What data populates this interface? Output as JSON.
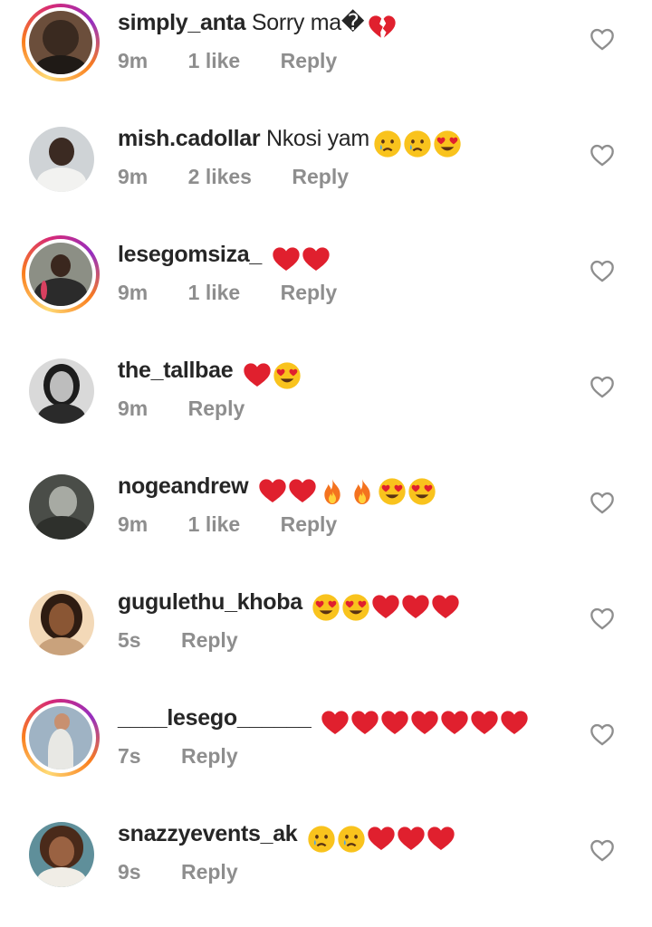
{
  "comments": [
    {
      "username": "simply_anta",
      "text": "Sorry ma�",
      "emojis": [
        "broken-heart"
      ],
      "time": "9m",
      "likes": "1 like",
      "reply": "Reply",
      "story": true
    },
    {
      "username": "mish.cadollar",
      "text": "Nkosi yam",
      "emojis": [
        "crying-face",
        "crying-face",
        "heart-eyes"
      ],
      "time": "9m",
      "likes": "2 likes",
      "reply": "Reply",
      "story": false
    },
    {
      "username": "lesegomsiza_",
      "text": "",
      "emojis": [
        "red-heart",
        "red-heart"
      ],
      "time": "9m",
      "likes": "1 like",
      "reply": "Reply",
      "story": true
    },
    {
      "username": "the_tallbae",
      "text": "",
      "emojis": [
        "red-heart",
        "heart-eyes"
      ],
      "time": "9m",
      "likes": "",
      "reply": "Reply",
      "story": false
    },
    {
      "username": "nogeandrew",
      "text": "",
      "emojis": [
        "red-heart",
        "red-heart",
        "fire",
        "fire",
        "heart-eyes",
        "heart-eyes"
      ],
      "time": "9m",
      "likes": "1 like",
      "reply": "Reply",
      "story": false
    },
    {
      "username": "gugulethu_khoba",
      "text": "",
      "emojis": [
        "heart-eyes",
        "heart-eyes",
        "red-heart",
        "red-heart",
        "red-heart"
      ],
      "time": "5s",
      "likes": "",
      "reply": "Reply",
      "story": false
    },
    {
      "username": "____lesego______",
      "text": "",
      "emojis": [
        "red-heart",
        "red-heart",
        "red-heart",
        "red-heart",
        "red-heart",
        "red-heart",
        "red-heart"
      ],
      "time": "7s",
      "likes": "",
      "reply": "Reply",
      "story": true
    },
    {
      "username": "snazzyevents_ak",
      "text": "",
      "emojis": [
        "crying-face",
        "crying-face",
        "red-heart",
        "red-heart",
        "red-heart"
      ],
      "time": "9s",
      "likes": "",
      "reply": "Reply",
      "story": false
    }
  ],
  "icons": {
    "like": "heart-outline-icon"
  },
  "colors": {
    "meta": "#8e8e8e",
    "heart": "#e0202e",
    "emoji": "#f9c31d"
  }
}
